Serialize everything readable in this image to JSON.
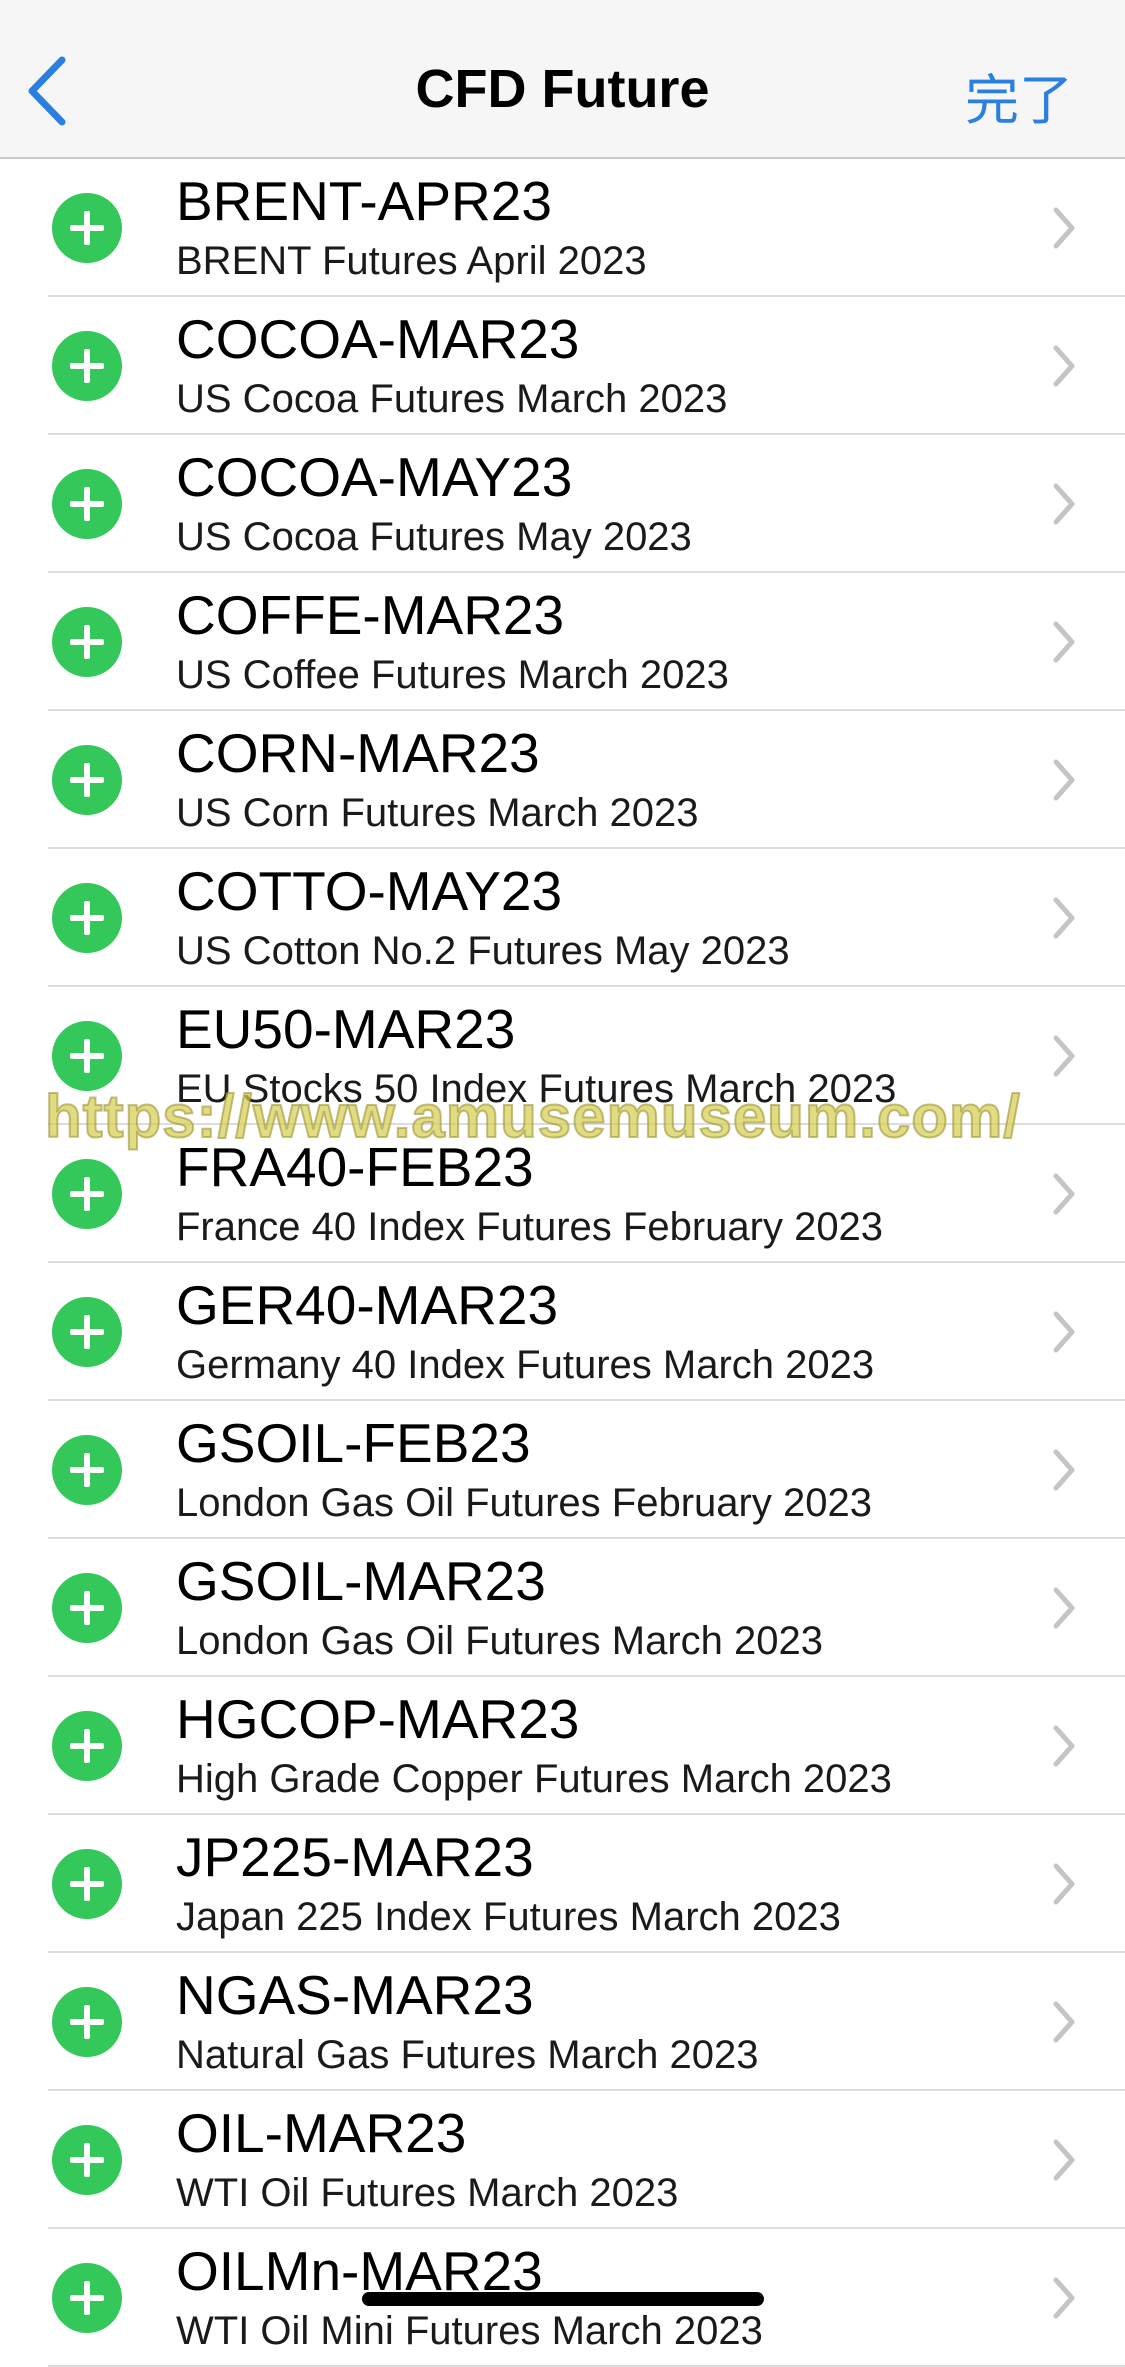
{
  "nav": {
    "title": "CFD Future",
    "done_label": "完了",
    "back_icon": "chevron-left-icon"
  },
  "colors": {
    "accent": "#2b7fe0",
    "add_green": "#34c759",
    "chevron": "#c4c4c7"
  },
  "items": [
    {
      "symbol": "BRENT-APR23",
      "description": "BRENT Futures April 2023"
    },
    {
      "symbol": "COCOA-MAR23",
      "description": "US Cocoa Futures March 2023"
    },
    {
      "symbol": "COCOA-MAY23",
      "description": "US Cocoa Futures May 2023"
    },
    {
      "symbol": "COFFE-MAR23",
      "description": "US Coffee Futures March 2023"
    },
    {
      "symbol": "CORN-MAR23",
      "description": "US Corn Futures March 2023"
    },
    {
      "symbol": "COTTO-MAY23",
      "description": "US Cotton No.2 Futures May 2023"
    },
    {
      "symbol": "EU50-MAR23",
      "description": "EU Stocks 50 Index Futures March 2023"
    },
    {
      "symbol": "FRA40-FEB23",
      "description": "France 40 Index Futures February 2023"
    },
    {
      "symbol": "GER40-MAR23",
      "description": "Germany 40 Index Futures March 2023"
    },
    {
      "symbol": "GSOIL-FEB23",
      "description": "London Gas Oil Futures February 2023"
    },
    {
      "symbol": "GSOIL-MAR23",
      "description": "London Gas Oil Futures March 2023"
    },
    {
      "symbol": "HGCOP-MAR23",
      "description": "High Grade Copper Futures March 2023"
    },
    {
      "symbol": "JP225-MAR23",
      "description": "Japan 225 Index Futures March 2023"
    },
    {
      "symbol": "NGAS-MAR23",
      "description": "Natural Gas Futures March 2023"
    },
    {
      "symbol": "OIL-MAR23",
      "description": "WTI Oil Futures March 2023"
    },
    {
      "symbol": "OILMn-MAR23",
      "description": "WTI Oil Mini Futures March 2023"
    }
  ],
  "watermark": "https://www.amusemuseum.com/"
}
